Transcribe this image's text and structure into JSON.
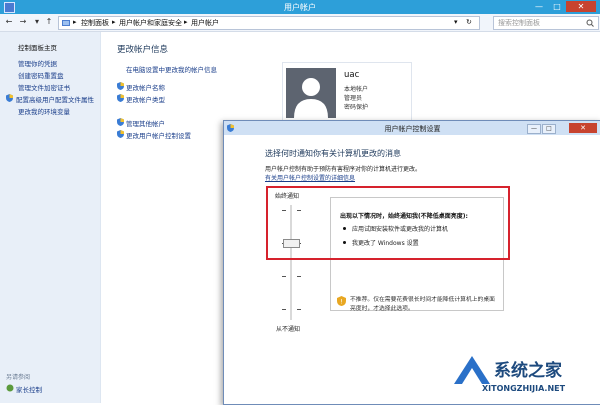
{
  "window": {
    "title": "用户帐户",
    "minimize": "—",
    "maximize": "□",
    "close": "✕"
  },
  "address": {
    "crumbs": [
      "控制面板",
      "用户帐户和家庭安全",
      "用户帐户"
    ],
    "separator": "▸",
    "search_placeholder": "搜索控制面板"
  },
  "sidebar": {
    "items": [
      {
        "label": "控制面板主页"
      },
      {
        "label": "管理你的凭据"
      },
      {
        "label": "创建密码重置盘"
      },
      {
        "label": "管理文件加密证书"
      },
      {
        "label": "配置高级用户配置文件属性"
      },
      {
        "label": "更改我的环境变量"
      }
    ],
    "see_also": "另请参阅",
    "family_safety": "家长控制"
  },
  "main": {
    "heading": "更改帐户信息",
    "links": [
      {
        "label": "在电脑设置中更改我的帐户信息",
        "shield": false
      },
      {
        "label": "更改帐户名称",
        "shield": true
      },
      {
        "label": "更改帐户类型",
        "shield": true
      },
      {
        "label": "管理其他帐户",
        "shield": true
      },
      {
        "label": "更改用户帐户控制设置",
        "shield": true
      }
    ],
    "user": {
      "name": "uac",
      "lines": [
        "本地帐户",
        "管理员",
        "密码保护"
      ]
    }
  },
  "uac_dialog": {
    "title": "用户帐户控制设置",
    "heading": "选择何时通知你有关计算机更改的消息",
    "description": "用户帐户控制有助于预防有害程序对你的计算机进行更改。",
    "more_link": "有关用户帐户控制设置的详细信息",
    "slider_top_label": "始终通知",
    "slider_bottom_label": "从不通知",
    "slider_level": 0.5,
    "notify_title": "出现以下情况时，始终通知我(不降低桌面亮度):",
    "bullets": [
      "应用试图安装软件或更改我的计算机",
      "我更改了 Windows 设置"
    ],
    "warning": "不推荐。仅在需要花费很长时间才能降低计算机上的桌面亮度时，才选择此选项。"
  },
  "watermark": {
    "text": "系统之家",
    "url": "XITONGZHIJIA.NET"
  },
  "colors": {
    "titlebar": "#2d9fd9",
    "close": "#c7432f",
    "link": "#1a3e8a",
    "highlight_box": "#d6222d"
  }
}
